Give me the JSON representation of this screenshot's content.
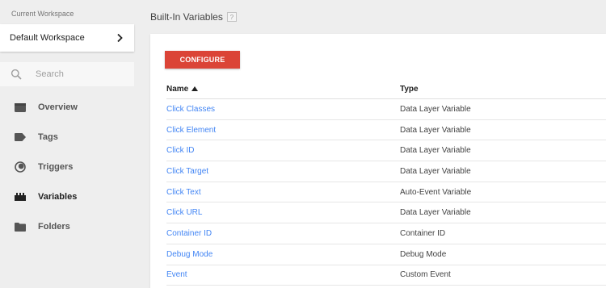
{
  "sidebar": {
    "workspace_label": "Current Workspace",
    "workspace_name": "Default Workspace",
    "search_placeholder": "Search",
    "nav": [
      {
        "label": "Overview",
        "icon": "overview-icon"
      },
      {
        "label": "Tags",
        "icon": "tag-icon"
      },
      {
        "label": "Triggers",
        "icon": "trigger-icon"
      },
      {
        "label": "Variables",
        "icon": "variables-icon"
      },
      {
        "label": "Folders",
        "icon": "folder-icon"
      }
    ],
    "active_item": "Variables"
  },
  "header": {
    "title": "Built-In Variables",
    "help_label": "?"
  },
  "main": {
    "configure_label": "CONFIGURE",
    "table": {
      "columns": [
        "Name",
        "Type"
      ],
      "sort_column": "Name",
      "sort_direction": "ascending",
      "rows": [
        {
          "name": "Click Classes",
          "type": "Data Layer Variable"
        },
        {
          "name": "Click Element",
          "type": "Data Layer Variable"
        },
        {
          "name": "Click ID",
          "type": "Data Layer Variable"
        },
        {
          "name": "Click Target",
          "type": "Data Layer Variable"
        },
        {
          "name": "Click Text",
          "type": "Auto-Event Variable"
        },
        {
          "name": "Click URL",
          "type": "Data Layer Variable"
        },
        {
          "name": "Container ID",
          "type": "Container ID"
        },
        {
          "name": "Debug Mode",
          "type": "Debug Mode"
        },
        {
          "name": "Event",
          "type": "Custom Event"
        }
      ]
    }
  },
  "colors": {
    "accent_red": "#db4437",
    "link_blue": "#4285f4",
    "sidebar_bg": "#eeeeee"
  }
}
